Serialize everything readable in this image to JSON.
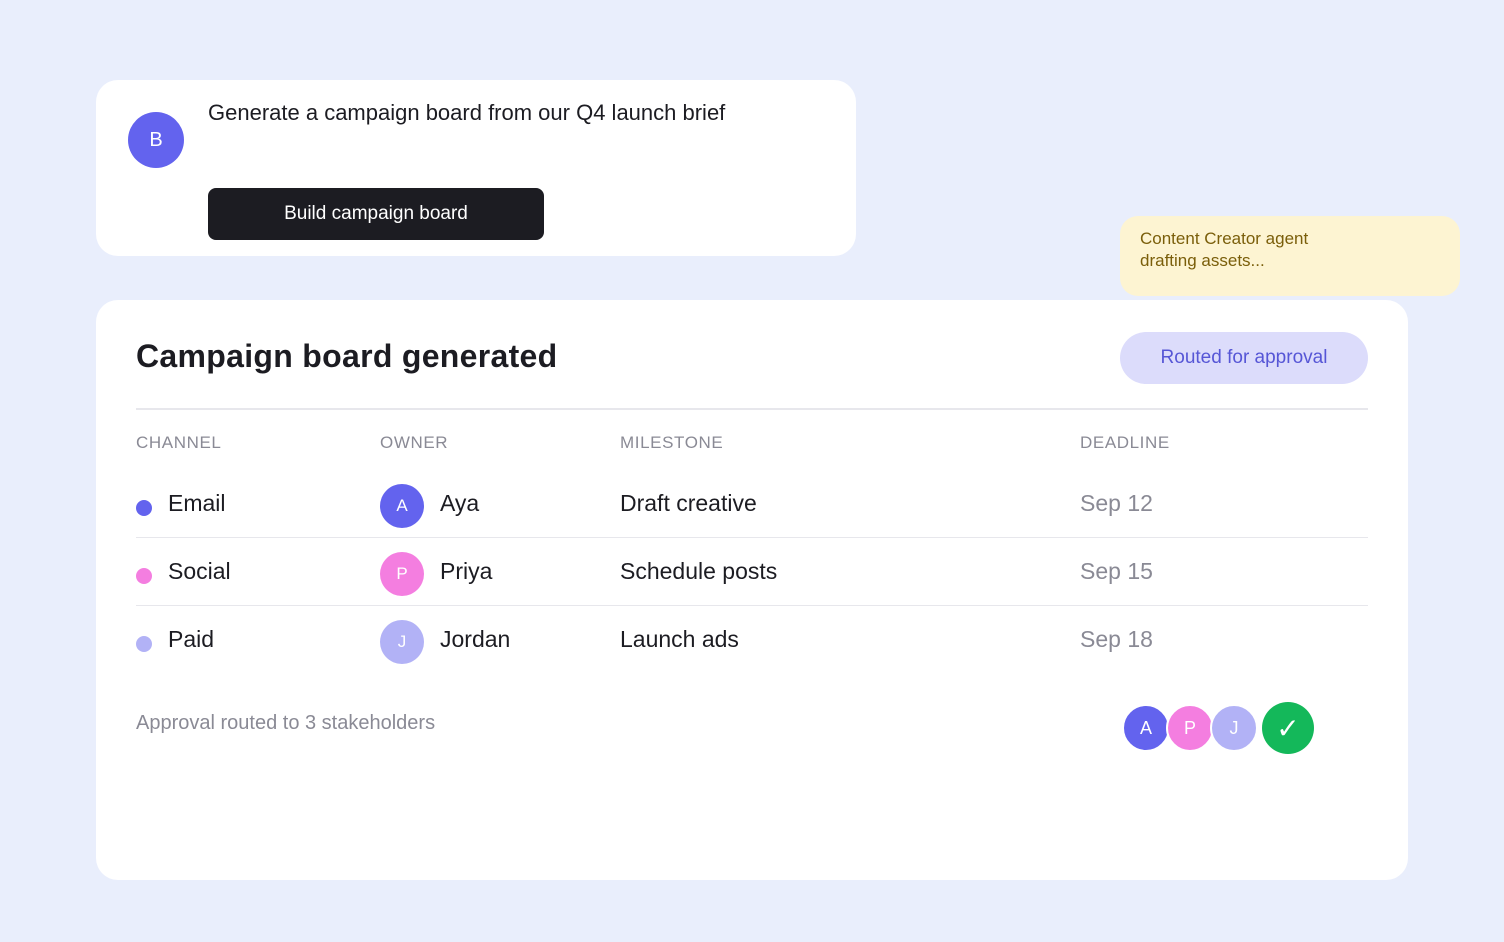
{
  "colors": {
    "background": "#e9eefc",
    "card": "#ffffff",
    "accent_indigo": "#6363ee",
    "pink": "#f47ee0",
    "lavender": "#b2b2f6",
    "dark_button": "#1c1c22",
    "toast_bg": "#fdf4d2",
    "toast_text": "#7a5e0a",
    "pill_bg": "#dcdcfb",
    "pill_text": "#5656d6",
    "success": "#14b85a",
    "muted_text": "#8a8a95"
  },
  "prompt": {
    "user_initial": "B",
    "text": "Generate a campaign board from our Q4 launch brief",
    "button_label": "Build campaign board"
  },
  "toast": {
    "line1": "Content Creator agent",
    "line2": "drafting assets..."
  },
  "board": {
    "title": "Campaign board generated",
    "status_label": "Routed for approval",
    "columns": [
      "CHANNEL",
      "OWNER",
      "MILESTONE",
      "DEADLINE"
    ],
    "rows": [
      {
        "channel": "Email",
        "owner_initial": "A",
        "owner": "Aya",
        "milestone": "Draft creative",
        "deadline": "Sep 12",
        "dot_color": "#6363ee",
        "avatar_color": "#6363ee"
      },
      {
        "channel": "Social",
        "owner_initial": "P",
        "owner": "Priya",
        "milestone": "Schedule posts",
        "deadline": "Sep 15",
        "dot_color": "#f47ee0",
        "avatar_color": "#f47ee0"
      },
      {
        "channel": "Paid",
        "owner_initial": "J",
        "owner": "Jordan",
        "milestone": "Launch ads",
        "deadline": "Sep 18",
        "dot_color": "#b2b2f6",
        "avatar_color": "#b2b2f6"
      }
    ],
    "footer_text": "Approval routed to 3 stakeholders",
    "stakeholders": [
      {
        "initial": "A",
        "color": "#6363ee"
      },
      {
        "initial": "P",
        "color": "#f47ee0"
      },
      {
        "initial": "J",
        "color": "#b2b2f6"
      }
    ],
    "approval_icon": "check-icon",
    "approval_glyph": "✓"
  }
}
